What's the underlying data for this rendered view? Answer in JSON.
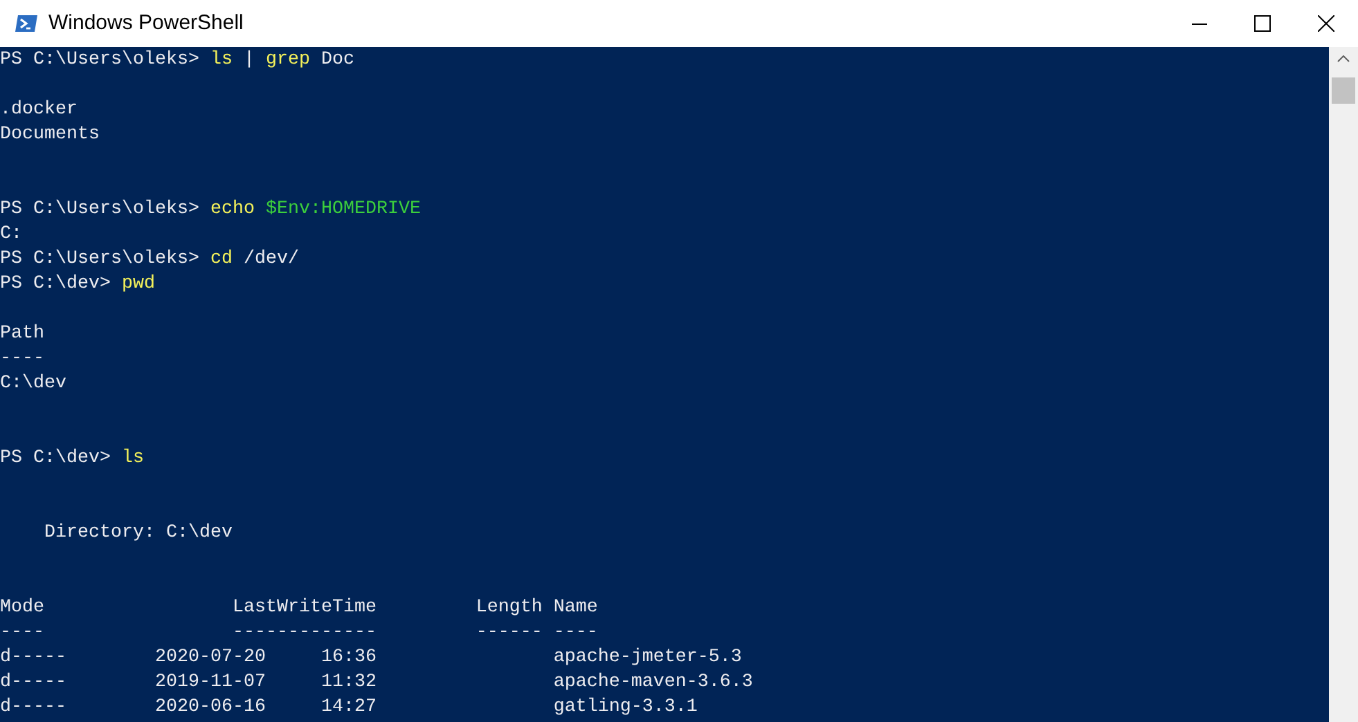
{
  "window": {
    "title": "Windows PowerShell"
  },
  "console": {
    "lines": [
      {
        "kind": "output",
        "segments": [
          {
            "kind": "plain",
            "text": "PS C:\\Users\\oleks> "
          },
          {
            "kind": "command",
            "text": "ls"
          },
          {
            "kind": "plain",
            "text": " | "
          },
          {
            "kind": "command",
            "text": "grep"
          },
          {
            "kind": "plain",
            "text": " Doc"
          }
        ]
      },
      {
        "kind": "blank"
      },
      {
        "kind": "output",
        "segments": [
          {
            "kind": "plain",
            "text": ".docker"
          }
        ]
      },
      {
        "kind": "output",
        "segments": [
          {
            "kind": "plain",
            "text": "Documents"
          }
        ]
      },
      {
        "kind": "blank"
      },
      {
        "kind": "blank"
      },
      {
        "kind": "output",
        "segments": [
          {
            "kind": "plain",
            "text": "PS C:\\Users\\oleks> "
          },
          {
            "kind": "command",
            "text": "echo"
          },
          {
            "kind": "variable",
            "text": " $Env:HOMEDRIVE"
          }
        ]
      },
      {
        "kind": "output",
        "segments": [
          {
            "kind": "plain",
            "text": "C:"
          }
        ]
      },
      {
        "kind": "output",
        "segments": [
          {
            "kind": "plain",
            "text": "PS C:\\Users\\oleks> "
          },
          {
            "kind": "command",
            "text": "cd"
          },
          {
            "kind": "plain",
            "text": " /dev/"
          }
        ]
      },
      {
        "kind": "output",
        "segments": [
          {
            "kind": "plain",
            "text": "PS C:\\dev> "
          },
          {
            "kind": "command",
            "text": "pwd"
          }
        ]
      },
      {
        "kind": "blank"
      },
      {
        "kind": "output",
        "segments": [
          {
            "kind": "plain",
            "text": "Path"
          }
        ]
      },
      {
        "kind": "output",
        "segments": [
          {
            "kind": "plain",
            "text": "----"
          }
        ]
      },
      {
        "kind": "output",
        "segments": [
          {
            "kind": "plain",
            "text": "C:\\dev"
          }
        ]
      },
      {
        "kind": "blank"
      },
      {
        "kind": "blank"
      },
      {
        "kind": "output",
        "segments": [
          {
            "kind": "plain",
            "text": "PS C:\\dev> "
          },
          {
            "kind": "command",
            "text": "ls"
          }
        ]
      },
      {
        "kind": "blank"
      },
      {
        "kind": "blank"
      },
      {
        "kind": "output",
        "segments": [
          {
            "kind": "plain",
            "text": "    Directory: C:\\dev"
          }
        ]
      },
      {
        "kind": "blank"
      },
      {
        "kind": "blank"
      },
      {
        "kind": "output",
        "segments": [
          {
            "kind": "plain",
            "text": "Mode                 LastWriteTime         Length Name"
          }
        ]
      },
      {
        "kind": "output",
        "segments": [
          {
            "kind": "plain",
            "text": "----                 -------------         ------ ----"
          }
        ]
      },
      {
        "kind": "output",
        "segments": [
          {
            "kind": "plain",
            "text": "d-----        2020-07-20     16:36                apache-jmeter-5.3"
          }
        ]
      },
      {
        "kind": "output",
        "segments": [
          {
            "kind": "plain",
            "text": "d-----        2019-11-07     11:32                apache-maven-3.6.3"
          }
        ]
      },
      {
        "kind": "output",
        "segments": [
          {
            "kind": "plain",
            "text": "d-----        2020-06-16     14:27                gatling-3.3.1"
          }
        ]
      }
    ]
  }
}
